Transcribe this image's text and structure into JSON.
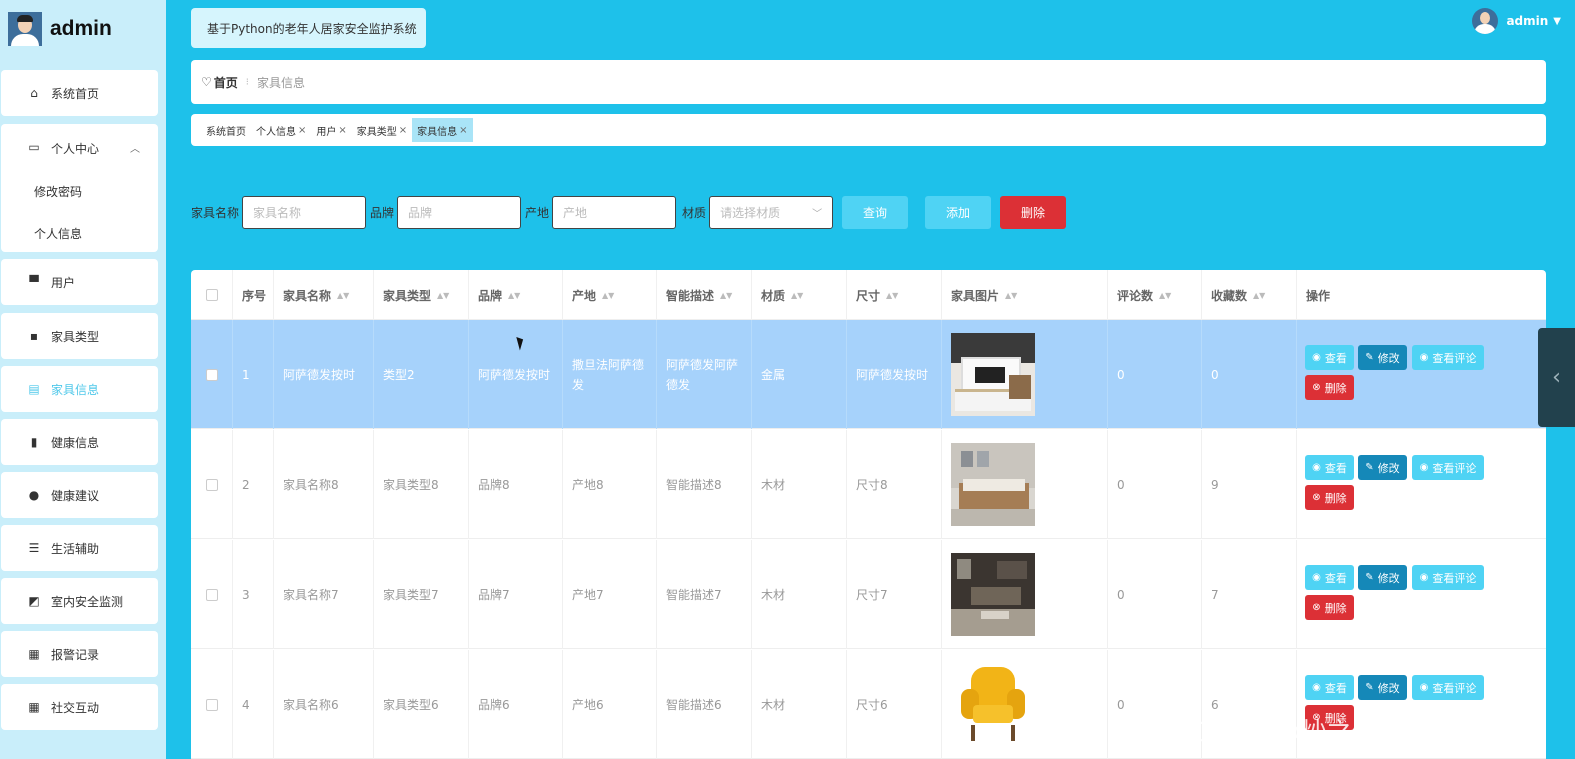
{
  "sidebar": {
    "brand": "admin",
    "menu": [
      {
        "label": "系统首页",
        "icon": "home-icon"
      },
      {
        "label": "个人中心",
        "icon": "profile-icon"
      },
      {
        "label": "用户",
        "icon": "monitor-icon"
      },
      {
        "label": "家具类型",
        "icon": "chat-icon"
      },
      {
        "label": "家具信息",
        "icon": "clipboard-icon"
      },
      {
        "label": "健康信息",
        "icon": "bar-chart-icon"
      },
      {
        "label": "健康建议",
        "icon": "person-icon"
      },
      {
        "label": "生活辅助",
        "icon": "list-icon"
      },
      {
        "label": "室内安全监测",
        "icon": "line-chart-icon"
      },
      {
        "label": "报警记录",
        "icon": "grid-icon"
      },
      {
        "label": "社交互动",
        "icon": "grid-icon"
      }
    ],
    "submenu": [
      "修改密码",
      "个人信息"
    ]
  },
  "header": {
    "system_title": "基于Python的老年人居家安全监护系统",
    "user": "admin"
  },
  "breadcrumb": {
    "home": "首页",
    "current": "家具信息"
  },
  "tags": [
    {
      "label": "系统首页",
      "closable": false
    },
    {
      "label": "个人信息",
      "closable": true
    },
    {
      "label": "用户",
      "closable": true
    },
    {
      "label": "家具类型",
      "closable": true
    },
    {
      "label": "家具信息",
      "closable": true
    }
  ],
  "search": {
    "name_label": "家具名称",
    "name_placeholder": "家具名称",
    "brand_label": "品牌",
    "brand_placeholder": "品牌",
    "origin_label": "产地",
    "origin_placeholder": "产地",
    "material_label": "材质",
    "material_placeholder": "请选择材质",
    "query_btn": "查询",
    "add_btn": "添加",
    "delete_btn": "删除"
  },
  "table": {
    "headers": [
      "序号",
      "家具名称",
      "家具类型",
      "品牌",
      "产地",
      "智能描述",
      "材质",
      "尺寸",
      "家具图片",
      "评论数",
      "收藏数",
      "操作"
    ],
    "rows": [
      {
        "idx": "1",
        "name": "阿萨德发按时",
        "type": "类型2",
        "brand": "阿萨德发按时",
        "origin": "撒旦法阿萨德发",
        "desc": "阿萨德发阿萨德发",
        "material": "金属",
        "size": "阿萨德发按时",
        "comments": "0",
        "favs": "0"
      },
      {
        "idx": "2",
        "name": "家具名称8",
        "type": "家具类型8",
        "brand": "品牌8",
        "origin": "产地8",
        "desc": "智能描述8",
        "material": "木材",
        "size": "尺寸8",
        "comments": "0",
        "favs": "9"
      },
      {
        "idx": "3",
        "name": "家具名称7",
        "type": "家具类型7",
        "brand": "品牌7",
        "origin": "产地7",
        "desc": "智能描述7",
        "material": "木材",
        "size": "尺寸7",
        "comments": "0",
        "favs": "7"
      },
      {
        "idx": "4",
        "name": "家具名称6",
        "type": "家具类型6",
        "brand": "品牌6",
        "origin": "产地6",
        "desc": "智能描述6",
        "material": "木材",
        "size": "尺寸6",
        "comments": "0",
        "favs": "6"
      }
    ],
    "actions": {
      "view": "查看",
      "edit": "修改",
      "view_comments": "查看评论",
      "delete": "删除"
    }
  },
  "watermark": "CSDN @炒之学姐_毕设源码",
  "colors": {
    "background": "#1ec1ea",
    "selected_row": "#a6d2fb",
    "primary": "#4fd3f4",
    "edit": "#1588b8",
    "danger": "#dc3036"
  }
}
